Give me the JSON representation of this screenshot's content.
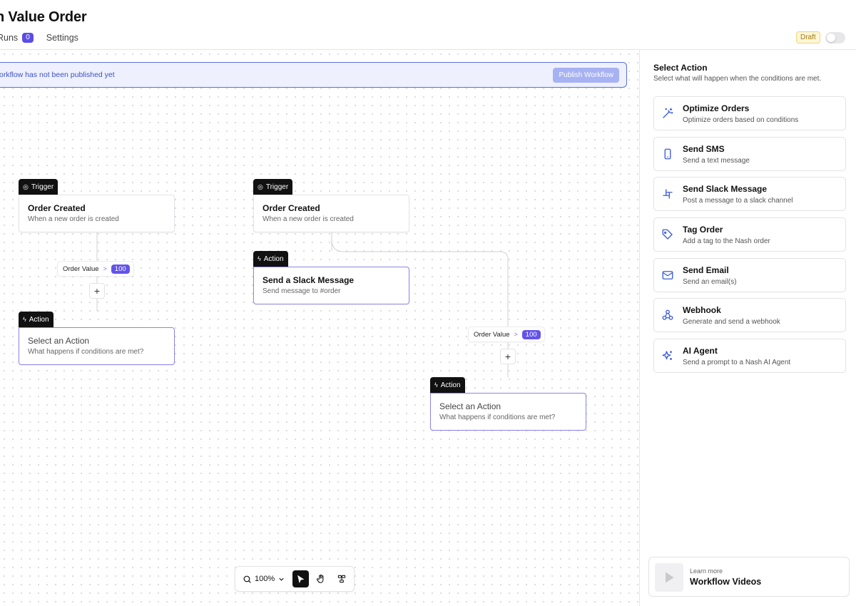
{
  "header": {
    "title": "h Value Order",
    "tabs": [
      {
        "label": "Runs",
        "count": "0"
      },
      {
        "label": "Settings"
      }
    ],
    "status_badge": "Draft"
  },
  "canvas": {
    "banner": {
      "text": "orkflow has not been published yet",
      "button": "Publish Workflow"
    },
    "nodes": [
      {
        "tag": "Trigger",
        "title": "Order Created",
        "subtitle": "When a new order is created"
      },
      {
        "tag": "Action",
        "title": "Select an Action",
        "subtitle": "What happens if conditions are met?"
      },
      {
        "tag": "Trigger",
        "title": "Order Created",
        "subtitle": "When a new order is created"
      },
      {
        "tag": "Action",
        "title": "Send a Slack Message",
        "subtitle": "Send message to #order"
      },
      {
        "tag": "Action",
        "title": "Select an Action",
        "subtitle": "What happens if conditions are met?"
      }
    ],
    "conditions": [
      {
        "field": "Order Value",
        "operator": ">",
        "value": "100"
      },
      {
        "field": "Order Value",
        "operator": ">",
        "value": "100"
      }
    ],
    "add_label": "+",
    "toolbar": {
      "zoom": "100%"
    }
  },
  "panel": {
    "title": "Select Action",
    "subtitle": "Select what will happen when the conditions are met.",
    "actions": [
      {
        "title": "Optimize Orders",
        "desc": "Optimize orders based on conditions",
        "icon": "magic-wand-icon"
      },
      {
        "title": "Send SMS",
        "desc": "Send a text message",
        "icon": "phone-icon"
      },
      {
        "title": "Send Slack Message",
        "desc": "Post a message to a slack channel",
        "icon": "slack-icon"
      },
      {
        "title": "Tag Order",
        "desc": "Add a tag to the Nash order",
        "icon": "tag-icon"
      },
      {
        "title": "Send Email",
        "desc": "Send an email(s)",
        "icon": "mail-icon"
      },
      {
        "title": "Webhook",
        "desc": "Generate and send a webhook",
        "icon": "webhook-icon"
      },
      {
        "title": "AI Agent",
        "desc": "Send a prompt to a Nash AI Agent",
        "icon": "sparkles-icon"
      }
    ],
    "learn_more": {
      "small": "Learn more",
      "title": "Workflow Videos"
    }
  },
  "colors": {
    "accent": "#5b4de6",
    "banner_border": "#5a6fe0",
    "icon_blue": "#3b5bdb"
  }
}
